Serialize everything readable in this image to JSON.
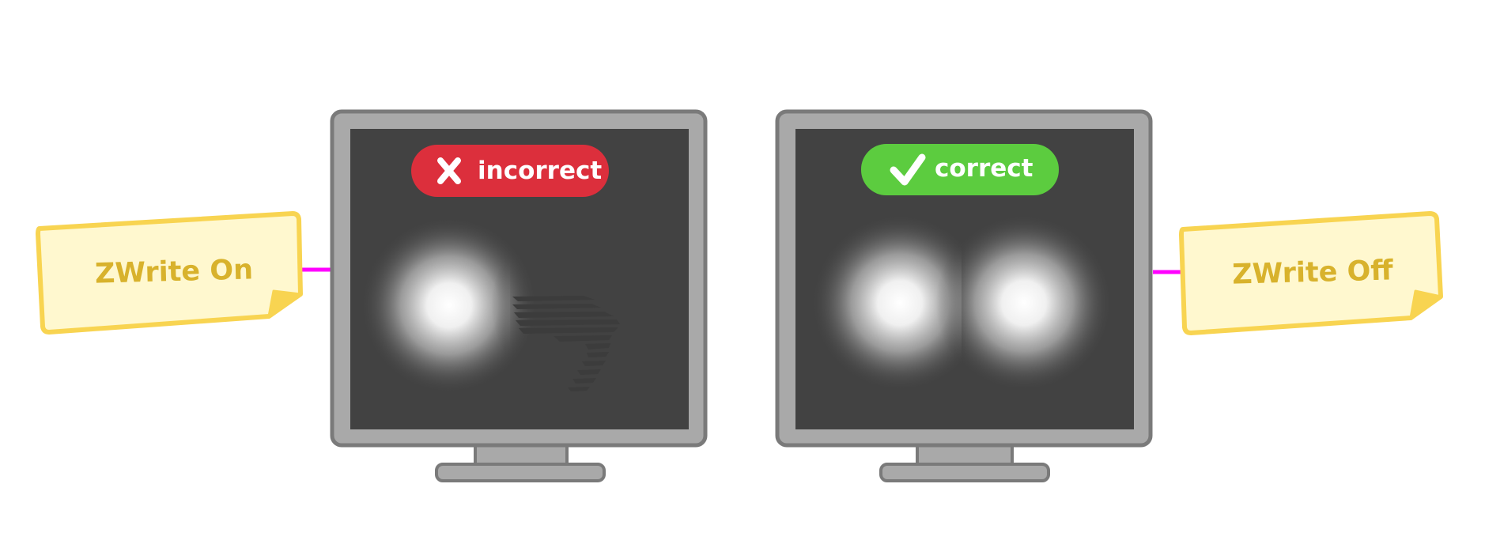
{
  "colors": {
    "background": "#ffffff",
    "monitor_bezel": "#a9a9a9",
    "monitor_outline": "#7a7a7a",
    "screen": "#424242",
    "connector": "#ff00ff",
    "note_fill": "#fff8cf",
    "note_border": "#f8d451",
    "note_text": "#d8b22c",
    "badge_incorrect": "#dc2f3c",
    "badge_correct": "#5ccc3f",
    "badge_text": "#ffffff"
  },
  "left_panel": {
    "note_label": "ZWrite On",
    "badge_label": "incorrect",
    "badge_icon": "cross-icon"
  },
  "right_panel": {
    "note_label": "ZWrite Off",
    "badge_label": "correct",
    "badge_icon": "checkmark-icon"
  }
}
